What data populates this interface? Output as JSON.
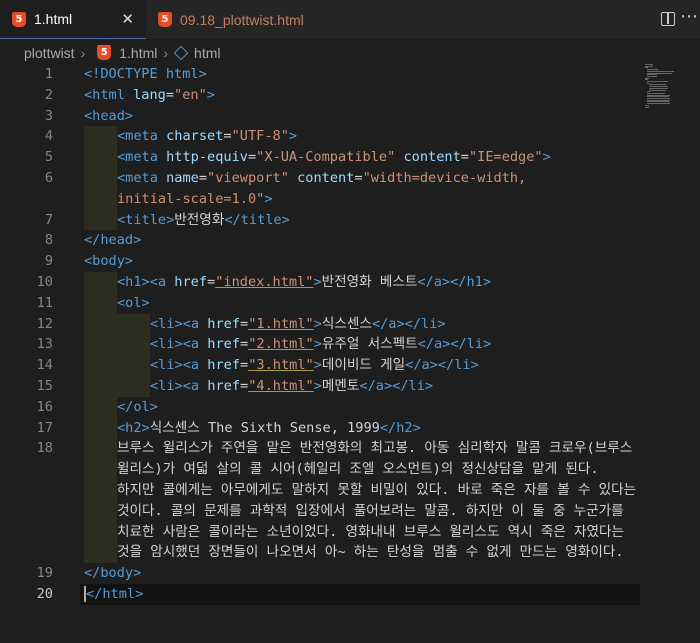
{
  "tabs": [
    {
      "label": "1.html",
      "icon": "html5-icon",
      "active": true
    },
    {
      "label": "09.18_plottwist.html",
      "icon": "html5-icon",
      "active": false
    }
  ],
  "breadcrumb": [
    "plottwist",
    "1.html",
    "html"
  ],
  "lines": [
    {
      "n": "1",
      "spans": [
        [
          "tag",
          "<!DOCTYPE html>"
        ]
      ]
    },
    {
      "n": "2",
      "spans": [
        [
          "tag",
          "<html "
        ],
        [
          "attr",
          "lang"
        ],
        [
          "txt",
          "="
        ],
        [
          "str",
          "\"en\""
        ],
        [
          "tag",
          ">"
        ]
      ]
    },
    {
      "n": "3",
      "spans": [
        [
          "tag",
          "<head>"
        ]
      ]
    },
    {
      "n": "4",
      "indent": 1,
      "spans": [
        [
          "tag",
          "<meta "
        ],
        [
          "attr",
          "charset"
        ],
        [
          "txt",
          "="
        ],
        [
          "str",
          "\"UTF-8\""
        ],
        [
          "tag",
          ">"
        ]
      ]
    },
    {
      "n": "5",
      "indent": 1,
      "spans": [
        [
          "tag",
          "<meta "
        ],
        [
          "attr",
          "http-equiv"
        ],
        [
          "txt",
          "="
        ],
        [
          "str",
          "\"X-UA-Compatible\""
        ],
        [
          "txt",
          " "
        ],
        [
          "attr",
          "content"
        ],
        [
          "txt",
          "="
        ],
        [
          "str",
          "\"IE=edge\""
        ],
        [
          "tag",
          ">"
        ]
      ]
    },
    {
      "n": "6",
      "indent": 1,
      "spans": [
        [
          "tag",
          "<meta "
        ],
        [
          "attr",
          "name"
        ],
        [
          "txt",
          "="
        ],
        [
          "str",
          "\"viewport\""
        ],
        [
          "txt",
          " "
        ],
        [
          "attr",
          "content"
        ],
        [
          "txt",
          "="
        ],
        [
          "str",
          "\"width=device-width,"
        ]
      ]
    },
    {
      "n": "",
      "indent": 1,
      "spans": [
        [
          "str",
          "initial-scale=1.0\""
        ],
        [
          "tag",
          ">"
        ]
      ]
    },
    {
      "n": "7",
      "indent": 1,
      "spans": [
        [
          "tag",
          "<title>"
        ],
        [
          "txt",
          "반전영화"
        ],
        [
          "tag",
          "</title>"
        ]
      ]
    },
    {
      "n": "8",
      "spans": [
        [
          "tag",
          "</head>"
        ]
      ]
    },
    {
      "n": "9",
      "spans": [
        [
          "tag",
          "<body>"
        ]
      ]
    },
    {
      "n": "10",
      "indent": 1,
      "spans": [
        [
          "tag",
          "<h1><a "
        ],
        [
          "attr",
          "href"
        ],
        [
          "txt",
          "="
        ],
        [
          "str",
          "\"index.html\""
        ],
        [
          "tag",
          ">"
        ],
        [
          "txt",
          "반전영화 베스트"
        ],
        [
          "tag",
          "</a></h1>"
        ]
      ]
    },
    {
      "n": "11",
      "indent": 1,
      "spans": [
        [
          "tag",
          "<ol>"
        ]
      ]
    },
    {
      "n": "12",
      "indent": 2,
      "spans": [
        [
          "tag",
          "<li><a "
        ],
        [
          "attr",
          "href"
        ],
        [
          "txt",
          "="
        ],
        [
          "str",
          "\"1.html\""
        ],
        [
          "tag",
          ">"
        ],
        [
          "txt",
          "식스센스"
        ],
        [
          "tag",
          "</a></li>"
        ]
      ]
    },
    {
      "n": "13",
      "indent": 2,
      "spans": [
        [
          "tag",
          "<li><a "
        ],
        [
          "attr",
          "href"
        ],
        [
          "txt",
          "="
        ],
        [
          "str",
          "\"2.html\""
        ],
        [
          "tag",
          ">"
        ],
        [
          "txt",
          "유주얼 서스펙트"
        ],
        [
          "tag",
          "</a></li>"
        ]
      ]
    },
    {
      "n": "14",
      "indent": 2,
      "spans": [
        [
          "tag",
          "<li><a "
        ],
        [
          "attr",
          "href"
        ],
        [
          "txt",
          "="
        ],
        [
          "str",
          "\"3.html\""
        ],
        [
          "tag",
          ">"
        ],
        [
          "txt",
          "데이비드 게일"
        ],
        [
          "tag",
          "</a></li>"
        ]
      ]
    },
    {
      "n": "15",
      "indent": 2,
      "spans": [
        [
          "tag",
          "<li><a "
        ],
        [
          "attr",
          "href"
        ],
        [
          "txt",
          "="
        ],
        [
          "str",
          "\"4.html\""
        ],
        [
          "tag",
          ">"
        ],
        [
          "txt",
          "메멘토"
        ],
        [
          "tag",
          "</a></li>"
        ]
      ]
    },
    {
      "n": "16",
      "indent": 1,
      "spans": [
        [
          "tag",
          "</ol>"
        ]
      ]
    },
    {
      "n": "17",
      "indent": 1,
      "spans": [
        [
          "tag",
          "<h2>"
        ],
        [
          "txt",
          "식스센스 The Sixth Sense, 1999"
        ],
        [
          "tag",
          "</h2>"
        ]
      ]
    },
    {
      "n": "18",
      "indent": 1,
      "spans": [
        [
          "txt",
          "브루스 윌리스가 주연을 맡은 반전영화의 최고봉. 아동 심리학자 말콤 크로우(브루스"
        ]
      ]
    },
    {
      "n": "",
      "indent": 1,
      "spans": [
        [
          "txt",
          "윌리스)가 여덟 살의 콜 시어(헤일리 조엘 오스먼트)의 정신상담을 맡게 된다."
        ]
      ]
    },
    {
      "n": "",
      "indent": 1,
      "spans": [
        [
          "txt",
          "하지만 콜에게는 아무에게도 말하지 못할 비밀이 있다. 바로 죽은 자를 볼 수 있다는"
        ]
      ]
    },
    {
      "n": "",
      "indent": 1,
      "spans": [
        [
          "txt",
          "것이다. 콜의 문제를 과학적 입장에서 풀어보려는 말콤. 하지만 이 둘 중 누군가를"
        ]
      ]
    },
    {
      "n": "",
      "indent": 1,
      "spans": [
        [
          "txt",
          "치료한 사람은 콜이라는 소년이었다. 영화내내 브루스 윌리스도 역시 죽은 자였다는"
        ]
      ]
    },
    {
      "n": "",
      "indent": 1,
      "spans": [
        [
          "txt",
          "것을 암시했던 장면들이 나오면서 아~ 하는 탄성을 멈출 수 없게 만드는 영화이다."
        ]
      ]
    },
    {
      "n": "19",
      "spans": [
        [
          "tag",
          "</body>"
        ]
      ]
    },
    {
      "n": "20",
      "current": true,
      "spans": [
        [
          "tag",
          "</html>"
        ]
      ]
    }
  ]
}
